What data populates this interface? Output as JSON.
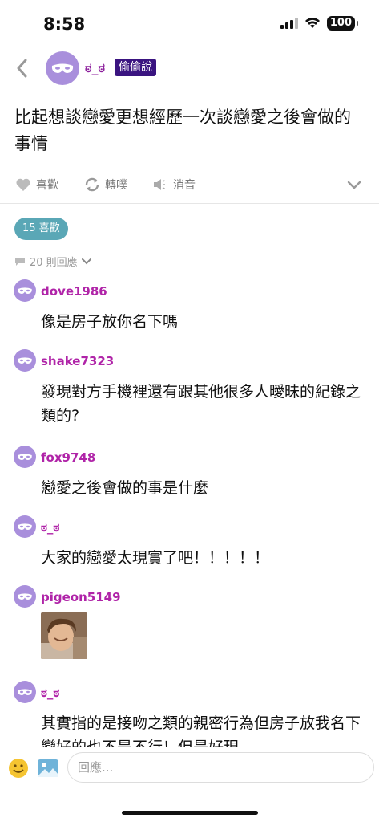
{
  "status_bar": {
    "time": "8:58",
    "battery": "100"
  },
  "header": {
    "author_name": "ಠ_ಠ",
    "board_badge": "偷偷說"
  },
  "post": {
    "title": "比起想談戀愛更想經歷一次談戀愛之後會做的事情"
  },
  "actions": {
    "like_label": "喜歡",
    "share_label": "轉噗",
    "mute_label": "消音"
  },
  "likes": {
    "label": "15 喜歡"
  },
  "replies_summary": {
    "label": "20 則回應"
  },
  "comments": [
    {
      "name": "dove1986",
      "text": "像是房子放你名下嗎"
    },
    {
      "name": "shake7323",
      "text": "發現對方手機裡還有跟其他很多人曖昧的紀錄之類的?"
    },
    {
      "name": "fox9748",
      "text": "戀愛之後會做的事是什麼"
    },
    {
      "name": "ಠ_ಠ",
      "text": "大家的戀愛太現實了吧！！！！！"
    },
    {
      "name": "pigeon5149",
      "text": ""
    },
    {
      "name": "ಠ_ಠ",
      "text": "其實指的是接吻之類的親密行為但房子放我名下變好的也不是不行！但是好現"
    }
  ],
  "input": {
    "placeholder": "回應..."
  },
  "colors": {
    "accent_purple": "#b024a8",
    "badge_bg": "#3a1480",
    "like_pill": "#5aa7b6",
    "avatar": "#a98fdc"
  },
  "icons": {
    "back": "chevron-left-icon",
    "avatar": "mask-icon",
    "like": "heart-icon",
    "share": "repeat-icon",
    "mute": "speaker-icon",
    "expand": "chevron-down-icon",
    "reply": "speech-bubble-icon",
    "emoji": "smiley-icon",
    "image": "image-icon"
  }
}
